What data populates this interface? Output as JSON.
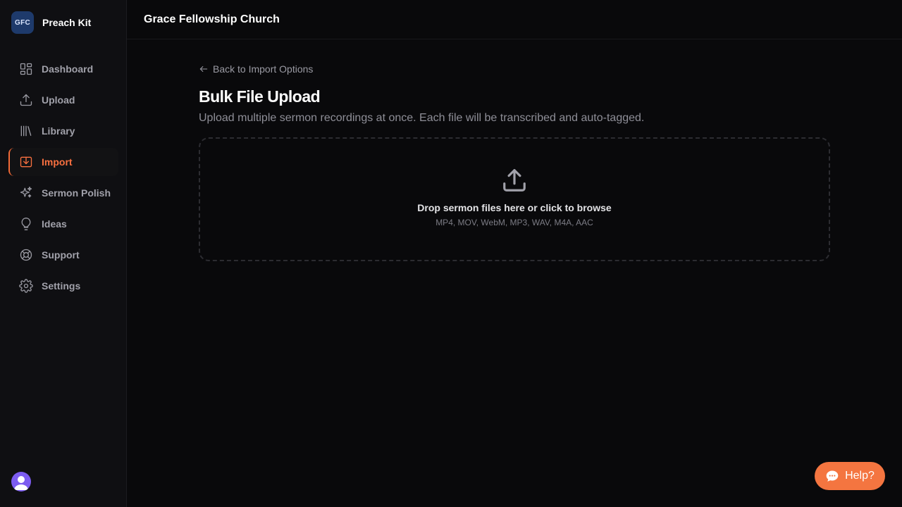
{
  "brand": {
    "logo_text": "GFC",
    "name": "Preach Kit"
  },
  "org_name": "Grace Fellowship Church",
  "sidebar": {
    "items": [
      {
        "label": "Dashboard",
        "icon": "dashboard-icon",
        "active": false
      },
      {
        "label": "Upload",
        "icon": "upload-icon",
        "active": false
      },
      {
        "label": "Library",
        "icon": "library-icon",
        "active": false
      },
      {
        "label": "Import",
        "icon": "import-icon",
        "active": true
      },
      {
        "label": "Sermon Polish",
        "icon": "sparkles-icon",
        "active": false
      },
      {
        "label": "Ideas",
        "icon": "lightbulb-icon",
        "active": false
      },
      {
        "label": "Support",
        "icon": "lifebuoy-icon",
        "active": false
      },
      {
        "label": "Settings",
        "icon": "gear-icon",
        "active": false
      }
    ]
  },
  "main": {
    "back_label": "Back to Import Options",
    "title": "Bulk File Upload",
    "subtitle": "Upload multiple sermon recordings at once. Each file will be transcribed and auto-tagged.",
    "dropzone": {
      "icon": "upload-icon",
      "label": "Drop sermon files here or click to browse",
      "formats": "MP4, MOV, WebM, MP3, WAV, M4A, AAC"
    }
  },
  "help_button": {
    "label": "Help?",
    "icon": "chat-bubble-icon"
  },
  "colors": {
    "accent": "#f97040",
    "background": "#09090b",
    "sidebar": "#0f0f12",
    "brand_logo": "#1e3a6b",
    "avatar": "#7c5cf0"
  }
}
